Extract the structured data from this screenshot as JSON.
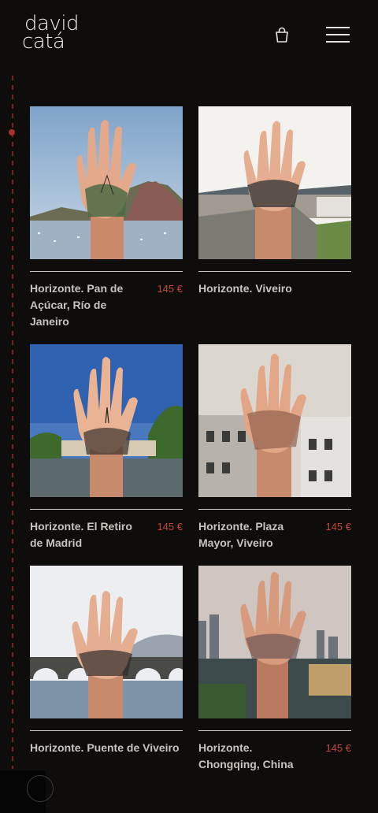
{
  "brand": {
    "line1": "david",
    "line2": "catá"
  },
  "header": {
    "cart_icon": "shopping-bag-icon",
    "menu_icon": "hamburger-menu-icon"
  },
  "products": [
    {
      "title": "Horizonte. Pan de Açúcar, Río de Janeiro",
      "price": "145 €"
    },
    {
      "title": "Horizonte. Viveiro",
      "price": ""
    },
    {
      "title": "Horizonte. El Retiro de Madrid",
      "price": "145 €"
    },
    {
      "title": "Horizonte. Plaza Mayor, Viveiro",
      "price": "145 €"
    },
    {
      "title": "Horizonte. Puente de Viveiro",
      "price": ""
    },
    {
      "title": "Horizonte. Chongqing, China",
      "price": "145 €"
    }
  ],
  "colors": {
    "background": "#0f0d0c",
    "price": "#c2463b",
    "timeline": "#7a2420"
  }
}
